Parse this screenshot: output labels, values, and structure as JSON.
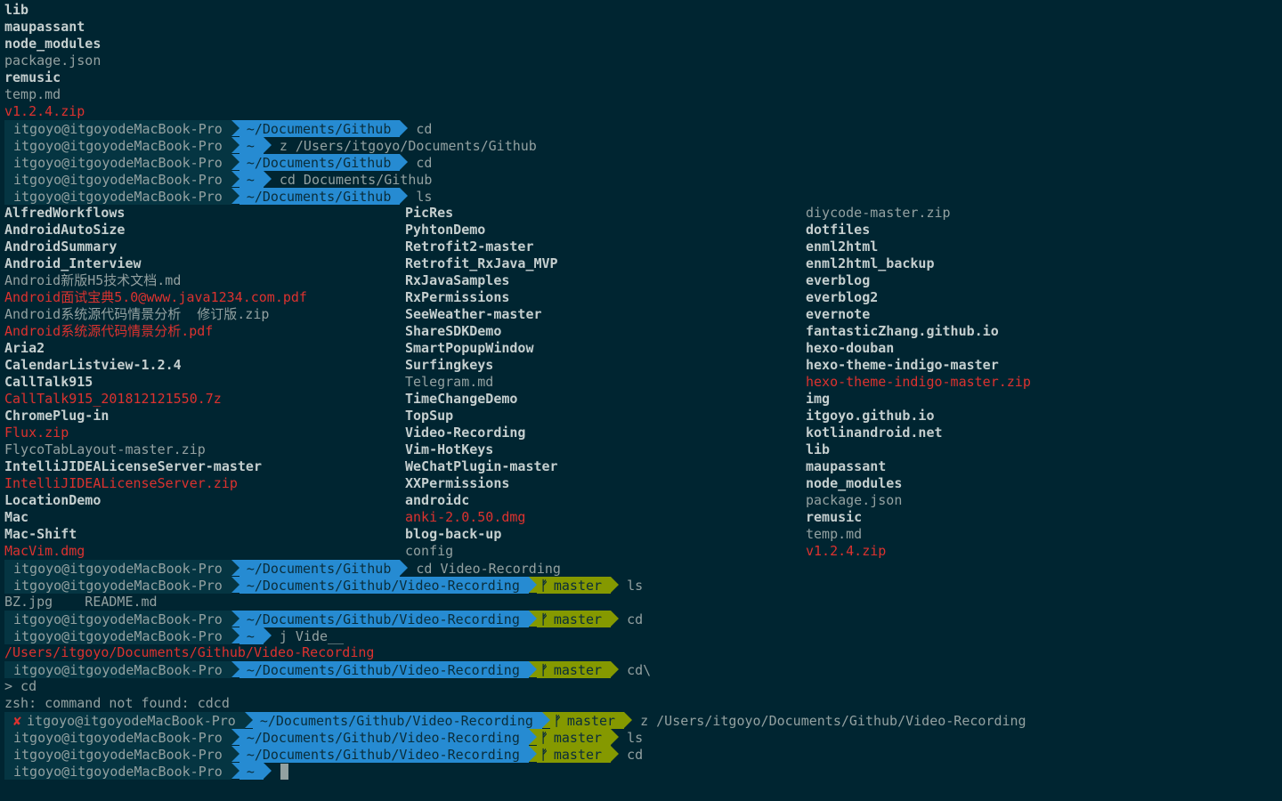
{
  "colors": {
    "background": "#002531",
    "text": "#93a1a1",
    "bold_text": "#c5cfcf",
    "red": "#dc322f",
    "context_bg": "#053542",
    "dir_bg": "#268bd2",
    "git_bg": "#859900"
  },
  "top_listing": [
    {
      "text": "lib",
      "style": "bold"
    },
    {
      "text": "maupassant",
      "style": "bold"
    },
    {
      "text": "node_modules",
      "style": "bold"
    },
    {
      "text": "package.json",
      "style": "norm"
    },
    {
      "text": "remusic",
      "style": "bold"
    },
    {
      "text": "temp.md",
      "style": "norm"
    },
    {
      "text": "v1.2.4.zip",
      "style": "red"
    }
  ],
  "prompts_a": [
    {
      "context": "itgoyo@itgoyodeMacBook-Pro",
      "dir": "~/Documents/Github",
      "command": "cd"
    },
    {
      "context": "itgoyo@itgoyodeMacBook-Pro",
      "dir": "~",
      "command": "z /Users/itgoyo/Documents/Github"
    },
    {
      "context": "itgoyo@itgoyodeMacBook-Pro",
      "dir": "~/Documents/Github",
      "command": "cd"
    },
    {
      "context": "itgoyo@itgoyodeMacBook-Pro",
      "dir": "~",
      "command": "cd Documents/Github"
    },
    {
      "context": "itgoyo@itgoyodeMacBook-Pro",
      "dir": "~/Documents/Github",
      "command": "ls"
    }
  ],
  "ls_rows": [
    [
      {
        "text": "AlfredWorkflows",
        "style": "bold"
      },
      {
        "text": "PicRes",
        "style": "bold"
      },
      {
        "text": "diycode-master.zip",
        "style": "norm"
      }
    ],
    [
      {
        "text": "AndroidAutoSize",
        "style": "bold"
      },
      {
        "text": "PyhtonDemo",
        "style": "bold"
      },
      {
        "text": "dotfiles",
        "style": "bold"
      }
    ],
    [
      {
        "text": "AndroidSummary",
        "style": "bold"
      },
      {
        "text": "Retrofit2-master",
        "style": "bold"
      },
      {
        "text": "enml2html",
        "style": "bold"
      }
    ],
    [
      {
        "text": "Android_Interview",
        "style": "bold"
      },
      {
        "text": "Retrofit_RxJava_MVP",
        "style": "bold"
      },
      {
        "text": "enml2html_backup",
        "style": "bold"
      }
    ],
    [
      {
        "text": "Android新版H5技术文档.md",
        "style": "norm"
      },
      {
        "text": "RxJavaSamples",
        "style": "bold"
      },
      {
        "text": "everblog",
        "style": "bold"
      }
    ],
    [
      {
        "text": "Android面试宝典5.0@www.java1234.com.pdf",
        "style": "red"
      },
      {
        "text": "RxPermissions",
        "style": "bold"
      },
      {
        "text": "everblog2",
        "style": "bold"
      }
    ],
    [
      {
        "text": "Android系统源代码情景分析  修订版.zip",
        "style": "norm"
      },
      {
        "text": "SeeWeather-master",
        "style": "bold"
      },
      {
        "text": "evernote",
        "style": "bold"
      }
    ],
    [
      {
        "text": "Android系统源代码情景分析.pdf",
        "style": "red"
      },
      {
        "text": "ShareSDKDemo",
        "style": "bold"
      },
      {
        "text": "fantasticZhang.github.io",
        "style": "bold"
      }
    ],
    [
      {
        "text": "Aria2",
        "style": "bold"
      },
      {
        "text": "SmartPopupWindow",
        "style": "bold"
      },
      {
        "text": "hexo-douban",
        "style": "bold"
      }
    ],
    [
      {
        "text": "CalendarListview-1.2.4",
        "style": "bold"
      },
      {
        "text": "Surfingkeys",
        "style": "bold"
      },
      {
        "text": "hexo-theme-indigo-master",
        "style": "bold"
      }
    ],
    [
      {
        "text": "CallTalk915",
        "style": "bold"
      },
      {
        "text": "Telegram.md",
        "style": "norm"
      },
      {
        "text": "hexo-theme-indigo-master.zip",
        "style": "red"
      }
    ],
    [
      {
        "text": "CallTalk915_201812121550.7z",
        "style": "red"
      },
      {
        "text": "TimeChangeDemo",
        "style": "bold"
      },
      {
        "text": "img",
        "style": "bold"
      }
    ],
    [
      {
        "text": "ChromePlug-in",
        "style": "bold"
      },
      {
        "text": "TopSup",
        "style": "bold"
      },
      {
        "text": "itgoyo.github.io",
        "style": "bold"
      }
    ],
    [
      {
        "text": "Flux.zip",
        "style": "red"
      },
      {
        "text": "Video-Recording",
        "style": "bold"
      },
      {
        "text": "kotlinandroid.net",
        "style": "bold"
      }
    ],
    [
      {
        "text": "FlycoTabLayout-master.zip",
        "style": "norm"
      },
      {
        "text": "Vim-HotKeys",
        "style": "bold"
      },
      {
        "text": "lib",
        "style": "bold"
      }
    ],
    [
      {
        "text": "IntelliJIDEALicenseServer-master",
        "style": "bold"
      },
      {
        "text": "WeChatPlugin-master",
        "style": "bold"
      },
      {
        "text": "maupassant",
        "style": "bold"
      }
    ],
    [
      {
        "text": "IntelliJIDEALicenseServer.zip",
        "style": "red"
      },
      {
        "text": "XXPermissions",
        "style": "bold"
      },
      {
        "text": "node_modules",
        "style": "bold"
      }
    ],
    [
      {
        "text": "LocationDemo",
        "style": "bold"
      },
      {
        "text": "androidc",
        "style": "bold"
      },
      {
        "text": "package.json",
        "style": "norm"
      }
    ],
    [
      {
        "text": "Mac",
        "style": "bold"
      },
      {
        "text": "anki-2.0.50.dmg",
        "style": "red"
      },
      {
        "text": "remusic",
        "style": "bold"
      }
    ],
    [
      {
        "text": "Mac-Shift",
        "style": "bold"
      },
      {
        "text": "blog-back-up",
        "style": "bold"
      },
      {
        "text": "temp.md",
        "style": "norm"
      }
    ],
    [
      {
        "text": "MacVim.dmg",
        "style": "red"
      },
      {
        "text": "config",
        "style": "norm"
      },
      {
        "text": "v1.2.4.zip",
        "style": "red"
      }
    ]
  ],
  "session": {
    "p1": {
      "context": "itgoyo@itgoyodeMacBook-Pro",
      "dir": "~/Documents/Github",
      "command": "cd Video-Recording"
    },
    "p2": {
      "context": "itgoyo@itgoyodeMacBook-Pro",
      "dir": "~/Documents/Github/Video-Recording",
      "branch": "master",
      "command": "ls"
    },
    "ls_out": "BZ.jpg    README.md",
    "p3": {
      "context": "itgoyo@itgoyodeMacBook-Pro",
      "dir": "~/Documents/Github/Video-Recording",
      "branch": "master",
      "command": "cd"
    },
    "p4": {
      "context": "itgoyo@itgoyodeMacBook-Pro",
      "dir": "~",
      "command": "j Vide__"
    },
    "jump_out": "/Users/itgoyo/Documents/Github/Video-Recording",
    "p5": {
      "context": "itgoyo@itgoyodeMacBook-Pro",
      "dir": "~/Documents/Github/Video-Recording",
      "branch": "master",
      "command": "cd\\"
    },
    "continuation": "> cd",
    "error_out": "zsh: command not found: cdcd",
    "p6": {
      "error_mark": "✘",
      "context": "itgoyo@itgoyodeMacBook-Pro",
      "dir": "~/Documents/Github/Video-Recording",
      "branch": "master",
      "command": "z /Users/itgoyo/Documents/Github/Video-Recording"
    },
    "p7": {
      "context": "itgoyo@itgoyodeMacBook-Pro",
      "dir": "~/Documents/Github/Video-Recording",
      "branch": "master",
      "command": "ls"
    },
    "p8": {
      "context": "itgoyo@itgoyodeMacBook-Pro",
      "dir": "~/Documents/Github/Video-Recording",
      "branch": "master",
      "command": "cd"
    },
    "p9": {
      "context": "itgoyo@itgoyodeMacBook-Pro",
      "dir": "~",
      "command": ""
    }
  },
  "branch_icon": "git-branch-icon"
}
